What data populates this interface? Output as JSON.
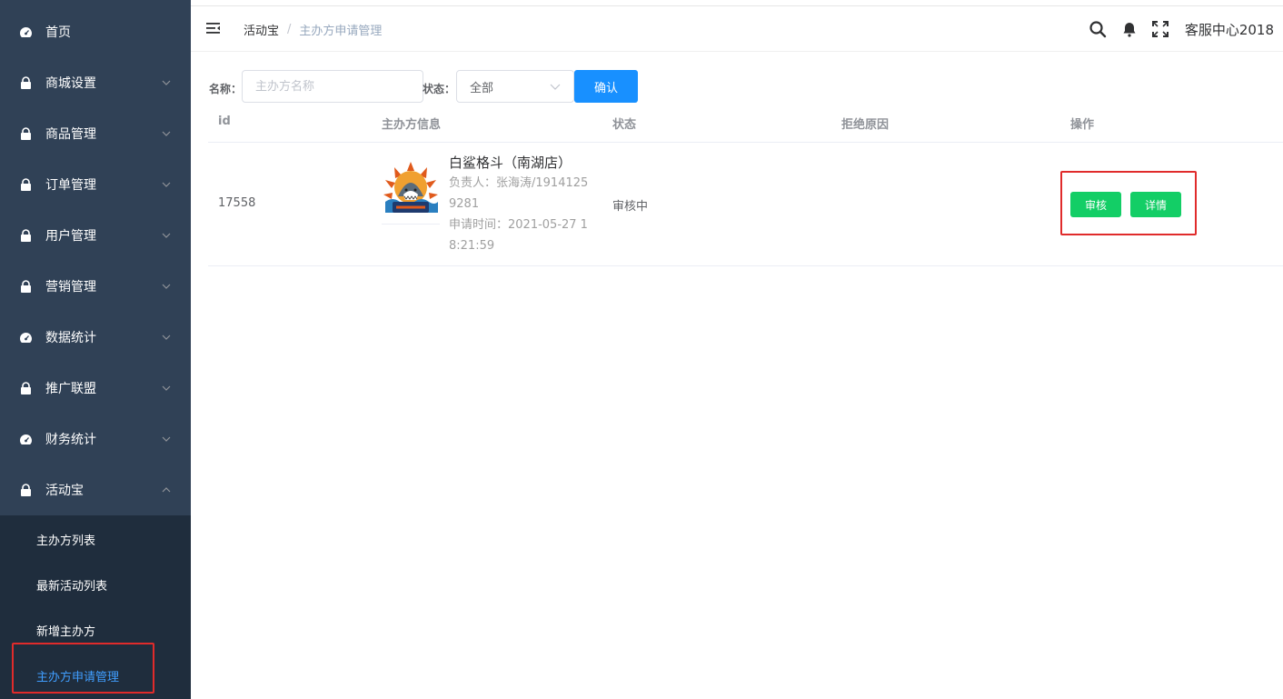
{
  "sidebar": {
    "items": [
      {
        "label": "首页",
        "icon": "dashboard-icon",
        "has_arrow": false
      },
      {
        "label": "商城设置",
        "icon": "lock-icon",
        "has_arrow": true
      },
      {
        "label": "商品管理",
        "icon": "lock-icon",
        "has_arrow": true
      },
      {
        "label": "订单管理",
        "icon": "lock-icon",
        "has_arrow": true
      },
      {
        "label": "用户管理",
        "icon": "lock-icon",
        "has_arrow": true
      },
      {
        "label": "营销管理",
        "icon": "lock-icon",
        "has_arrow": true
      },
      {
        "label": "数据统计",
        "icon": "dashboard-icon",
        "has_arrow": true
      },
      {
        "label": "推广联盟",
        "icon": "lock-icon",
        "has_arrow": true
      },
      {
        "label": "财务统计",
        "icon": "dashboard-icon",
        "has_arrow": true
      },
      {
        "label": "活动宝",
        "icon": "lock-icon",
        "has_arrow": true,
        "expanded": true
      }
    ],
    "submenu": [
      {
        "label": "主办方列表"
      },
      {
        "label": "最新活动列表"
      },
      {
        "label": "新增主办方"
      },
      {
        "label": "主办方申请管理",
        "active": true
      }
    ]
  },
  "header": {
    "breadcrumb": [
      "活动宝",
      "主办方申请管理"
    ],
    "separator": "/",
    "user": "客服中心2018"
  },
  "filter": {
    "name_label": "名称：",
    "name_placeholder": "主办方名称",
    "status_label": "状态：",
    "status_value": "全部",
    "confirm_label": "确认"
  },
  "table": {
    "columns": [
      "id",
      "主办方信息",
      "状态",
      "拒绝原因",
      "操作"
    ],
    "rows": [
      {
        "id": "17558",
        "name": "白鲨格斗（南湖店）",
        "contact_line1": "负责人：张海涛/1914125",
        "contact_line2": "9281",
        "time_line1": "申请时间：2021-05-27 1",
        "time_line2": "8:21:59",
        "status": "审核中",
        "reject_reason": "",
        "action_review": "审核",
        "action_detail": "详情"
      }
    ]
  },
  "colors": {
    "sidebar_bg": "#304156",
    "submenu_bg": "#1f2d3d",
    "active_link": "#409eff",
    "primary": "#1890ff",
    "success": "#13ce66",
    "highlight_box": "#e02b2b"
  }
}
